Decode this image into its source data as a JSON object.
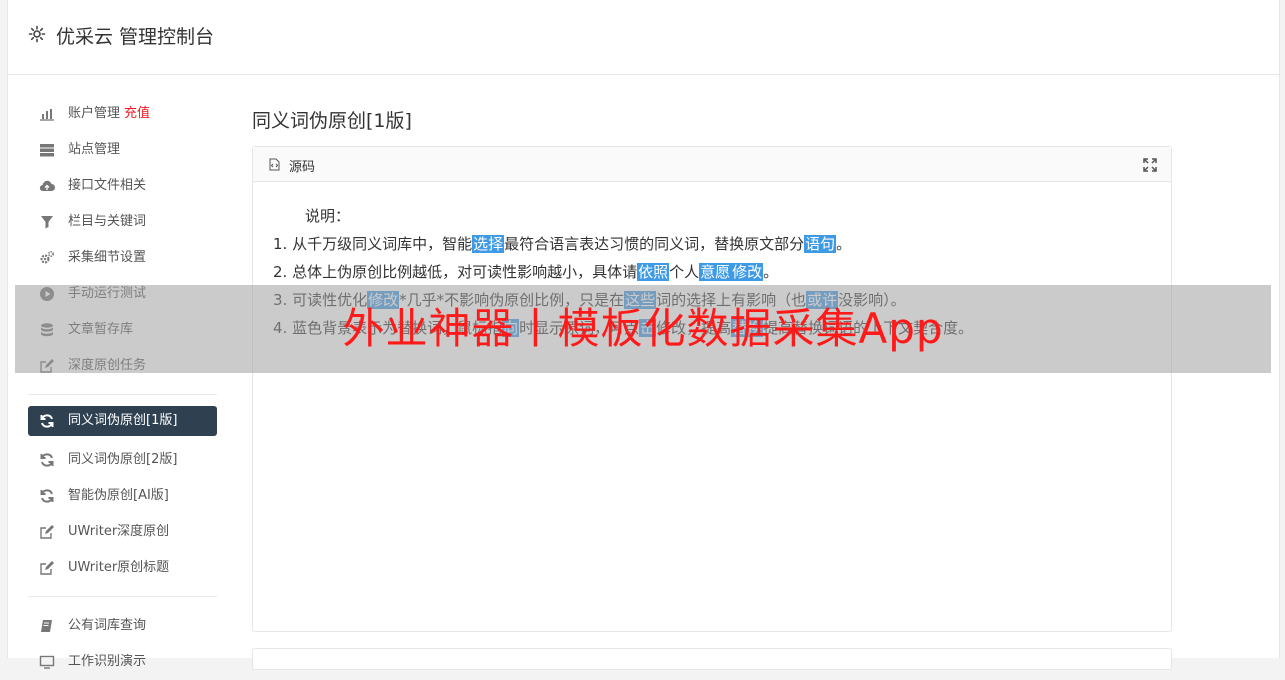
{
  "header": {
    "title": "优采云 管理控制台"
  },
  "sidebar": {
    "items": [
      {
        "label": "账户管理",
        "badge": "充值",
        "icon": "bar-chart-icon"
      },
      {
        "label": "站点管理",
        "icon": "server-icon"
      },
      {
        "label": "接口文件相关",
        "icon": "cloud-upload-icon"
      },
      {
        "label": "栏目与关键词",
        "icon": "filter-icon"
      },
      {
        "label": "采集细节设置",
        "icon": "cogs-icon"
      },
      {
        "label": "手动运行测试",
        "icon": "play-circle-icon"
      },
      {
        "label": "文章暂存库",
        "icon": "database-icon"
      },
      {
        "label": "深度原创任务",
        "icon": "edit-icon"
      }
    ],
    "items2": [
      {
        "label": "同义词伪原创[1版]",
        "icon": "refresh-icon",
        "active": true
      },
      {
        "label": "同义词伪原创[2版]",
        "icon": "refresh-icon"
      },
      {
        "label": "智能伪原创[AI版]",
        "icon": "refresh-icon"
      },
      {
        "label": "UWriter深度原创",
        "icon": "edit-icon"
      },
      {
        "label": "UWriter原创标题",
        "icon": "edit-icon"
      }
    ],
    "items3": [
      {
        "label": "公有词库查询",
        "icon": "book-icon"
      },
      {
        "label": "工作识别演示",
        "icon": "monitor-icon"
      }
    ]
  },
  "main": {
    "heading": "同义词伪原创[1版]",
    "panel": {
      "title": "源码",
      "lines": [
        {
          "parts": [
            "说明："
          ]
        },
        {
          "parts": [
            "1. 从千万级同义词库中，智能",
            {
              "hl": "选择"
            },
            "最符合语言表达习惯的同义词，替换原文部分",
            {
              "hl": "语句"
            },
            "。"
          ]
        },
        {
          "parts": [
            "2. 总体上伪原创比例越低，对可读性影响越小，具体请",
            {
              "hl": "依照"
            },
            "个人",
            {
              "hl": "意愿"
            },
            {
              "hl": "修改"
            },
            "。"
          ]
        },
        {
          "parts": [
            "3. 可读性优化",
            {
              "hl": "修改"
            },
            "*几乎*不影响伪原创比例，只是在",
            {
              "hl": "这些"
            },
            "词的选择上有影响（也",
            {
              "hl": "或许"
            },
            "没影响）。"
          ]
        },
        {
          "parts": [
            "4. 蓝色背景表示为替换词，鼠标指",
            {
              "hl": "向"
            },
            "时显示原词，可点",
            {
              "hl": "击"
            },
            "修改，提高",
            {
              "hl": "替换"
            },
            "提高替换词语的上下文契合度。"
          ]
        }
      ]
    }
  },
  "overlay": {
    "text": "外业神器丨模板化数据采集App"
  }
}
